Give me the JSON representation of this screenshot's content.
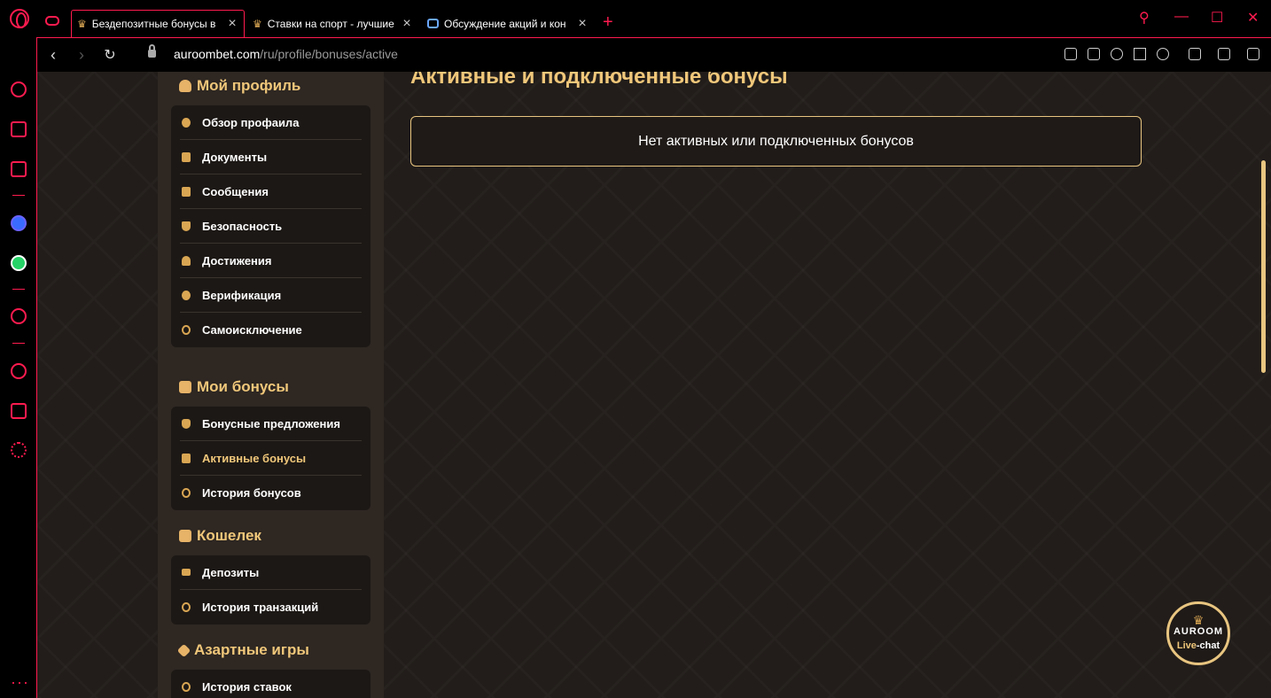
{
  "browser": {
    "tabs": [
      {
        "title": "Бездепозитные бонусы в",
        "favicon": "crown-icon",
        "active": true
      },
      {
        "title": "Ставки на спорт - лучшие",
        "favicon": "crown-icon",
        "active": false
      },
      {
        "title": "Обсуждение акций и кон",
        "favicon": "chat-icon",
        "active": false
      }
    ],
    "url_host": "auroombet.com",
    "url_path": "/ru/profile/bonuses/active",
    "accent": "#ff1b4f"
  },
  "sidebar": {
    "profile_title": "Мой профиль",
    "profile_items": [
      {
        "label": "Обзор профаила",
        "icon": "user-icon"
      },
      {
        "label": "Документы",
        "icon": "document-icon"
      },
      {
        "label": "Сообщения",
        "icon": "message-icon"
      },
      {
        "label": "Безопасность",
        "icon": "shield-icon"
      },
      {
        "label": "Достижения",
        "icon": "trophy-icon"
      },
      {
        "label": "Верификация",
        "icon": "verification-icon"
      },
      {
        "label": "Самоисключение",
        "icon": "block-icon"
      }
    ],
    "bonuses_title": "Мои бонусы",
    "bonuses_items": [
      {
        "label": "Бонусные предложения",
        "icon": "money-bag-icon"
      },
      {
        "label": "Активные бонусы",
        "icon": "ticket-icon",
        "active": true
      },
      {
        "label": "История бонусов",
        "icon": "history-icon"
      }
    ],
    "wallet_title": "Кошелек",
    "wallet_items": [
      {
        "label": "Депозиты",
        "icon": "card-icon"
      },
      {
        "label": "История транзакций",
        "icon": "history-icon"
      }
    ],
    "games_title": "Азартные игры",
    "games_items": [
      {
        "label": "История ставок",
        "icon": "history-icon"
      }
    ]
  },
  "main": {
    "title": "Активные и подключенные бонусы",
    "empty_message": "Нет активных или подключенных бонусов"
  },
  "chat": {
    "brand": "AUROOM",
    "live": "Live",
    "chat": "-chat"
  },
  "colors": {
    "gold": "#f0c77a",
    "background": "#221d1a"
  }
}
